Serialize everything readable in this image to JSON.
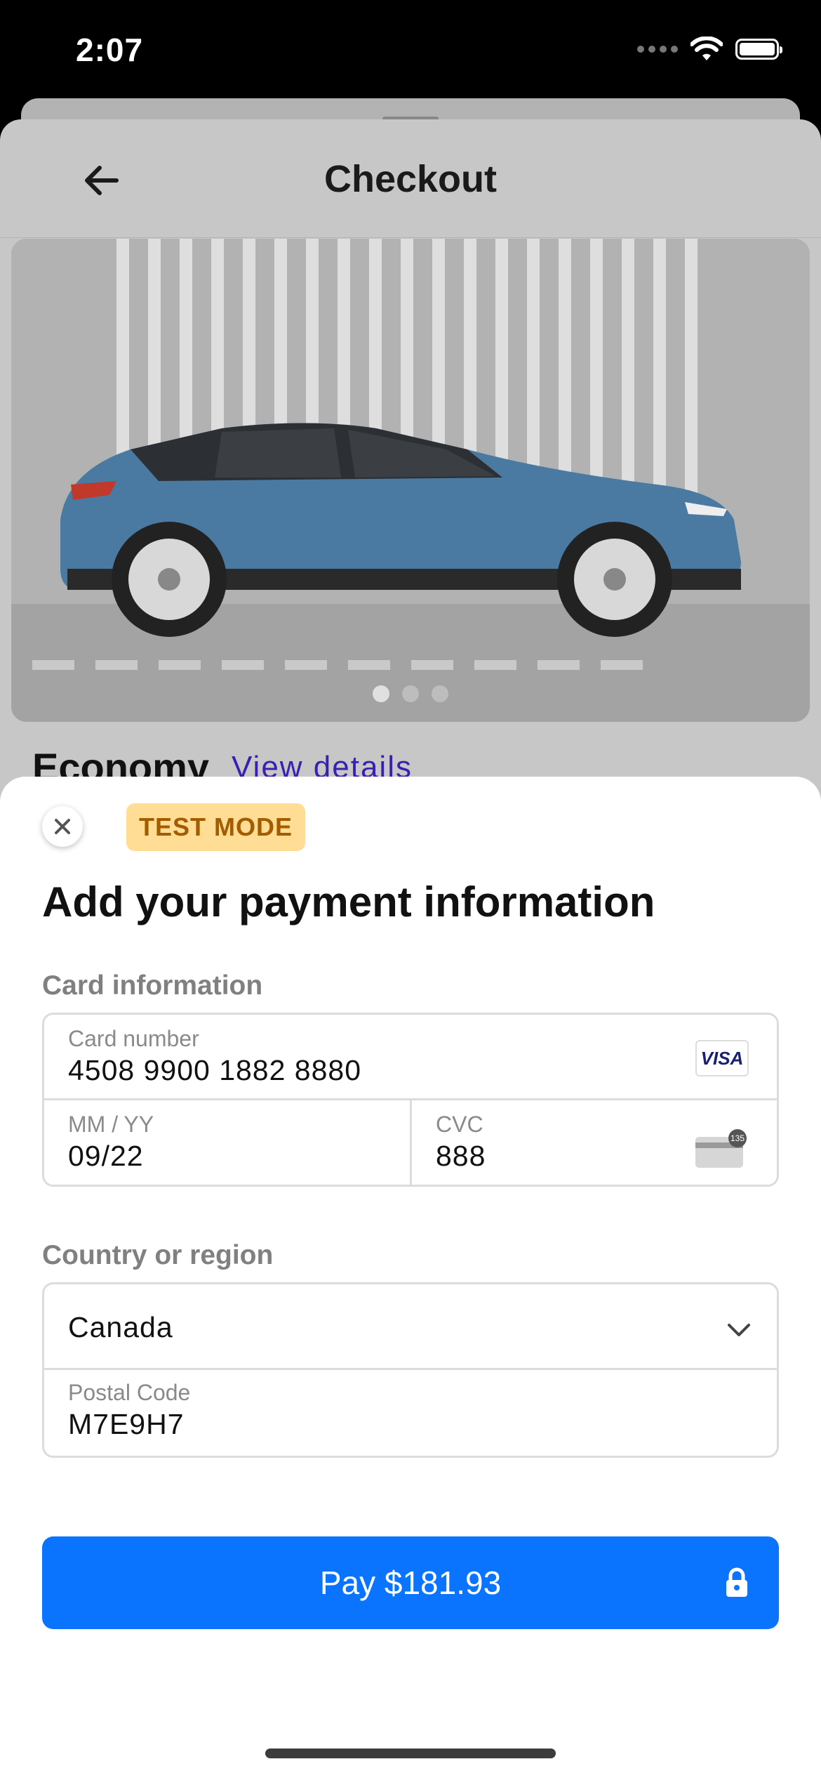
{
  "status_bar": {
    "time": "2:07"
  },
  "checkout": {
    "title": "Checkout",
    "product_title": "Economy",
    "view_details": "View details"
  },
  "payment_sheet": {
    "badge": "TEST MODE",
    "title": "Add your payment information",
    "card_section_label": "Card information",
    "card_number": {
      "label": "Card number",
      "value": "4508 9900 1882 8880",
      "brand_icon": "VISA"
    },
    "expiry": {
      "label": "MM / YY",
      "value": "09/22"
    },
    "cvc": {
      "label": "CVC",
      "value": "888",
      "icon_hint": "135"
    },
    "country_section_label": "Country or region",
    "country": {
      "value": "Canada"
    },
    "postal": {
      "label": "Postal Code",
      "value": "M7E9H7"
    },
    "pay_button": "Pay $181.93"
  }
}
